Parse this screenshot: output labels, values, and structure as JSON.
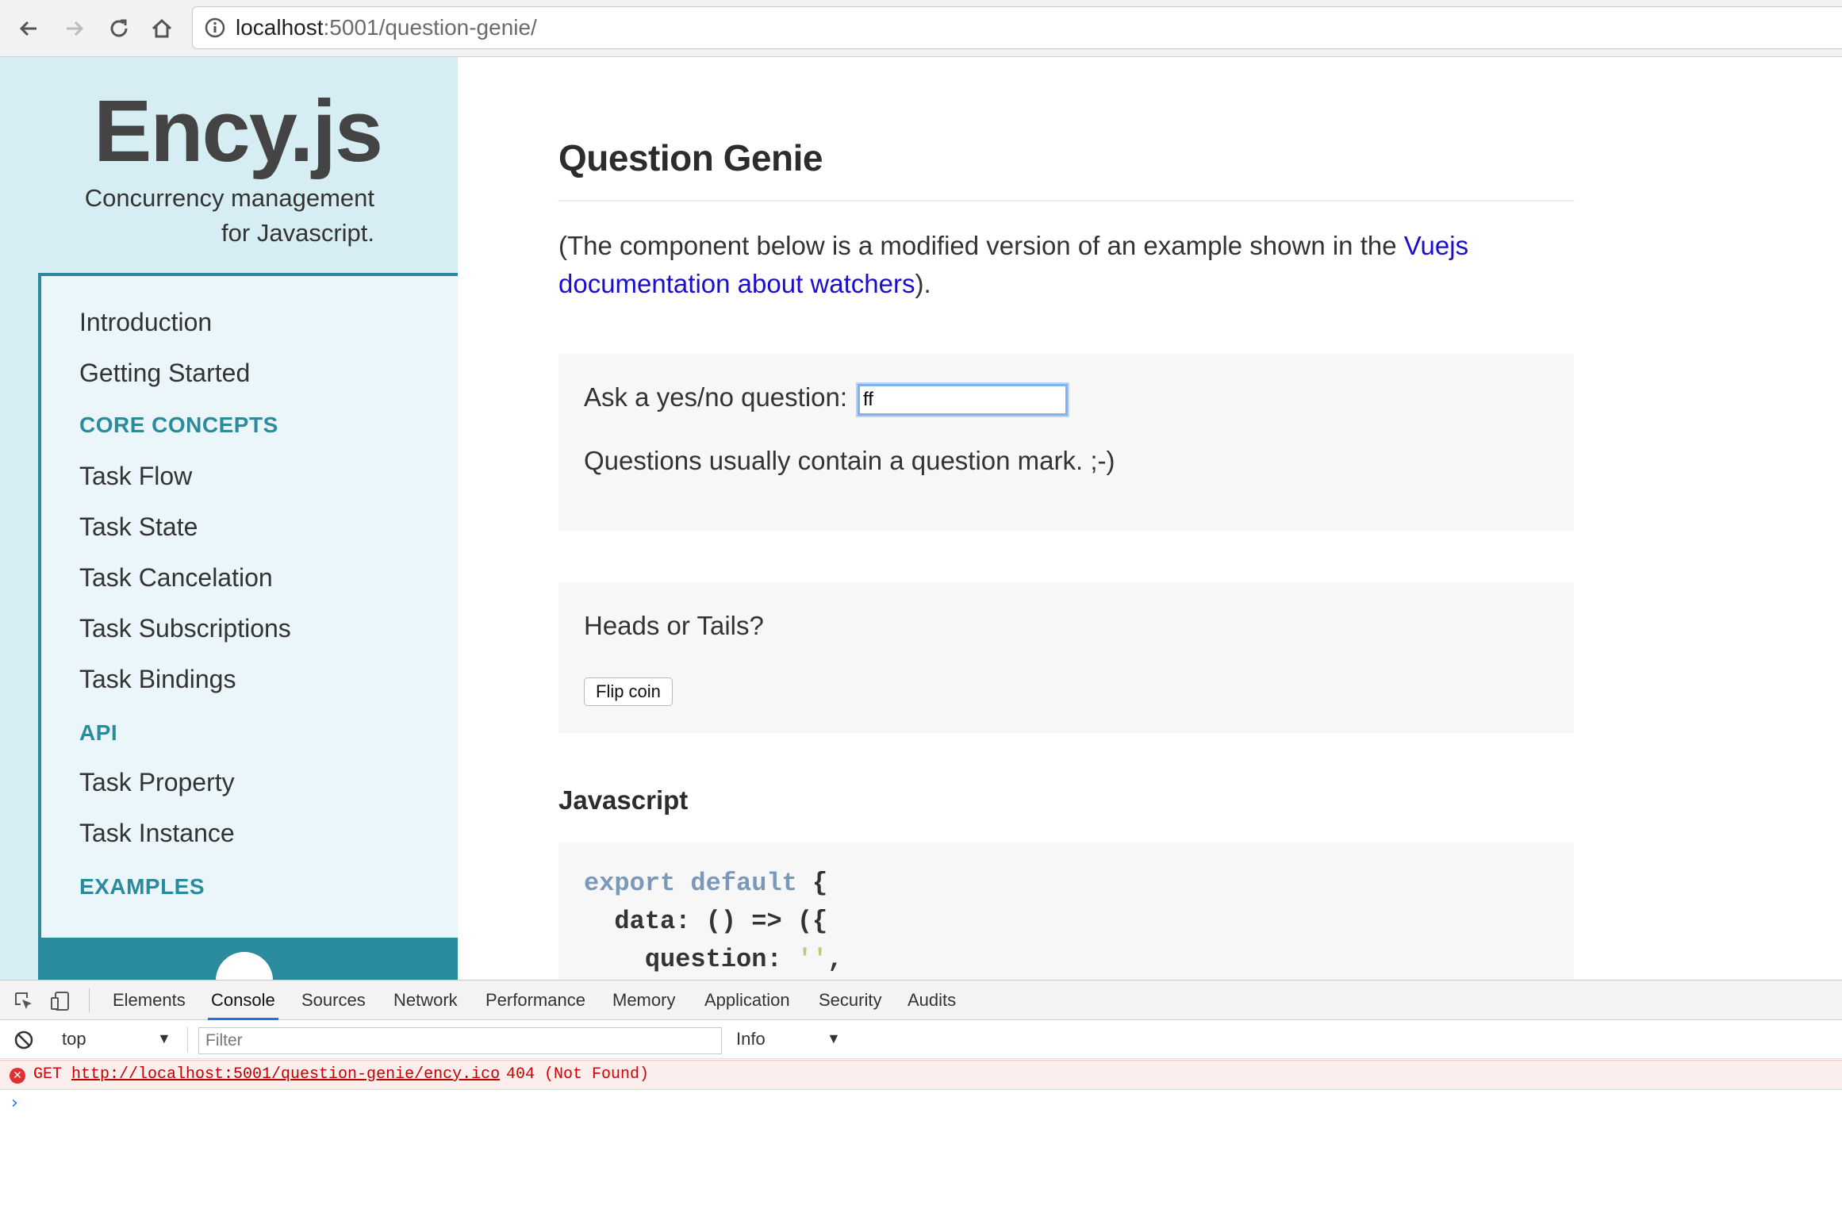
{
  "browser": {
    "url_host": "localhost",
    "url_path": ":5001/question-genie/"
  },
  "sidebar": {
    "brand_title": "Ency.js",
    "brand_subtitle_line1": "Concurrency management",
    "brand_subtitle_line2": "for Javascript.",
    "items": [
      {
        "label": "Introduction",
        "type": "link"
      },
      {
        "label": "Getting Started",
        "type": "link"
      },
      {
        "label": "CORE CONCEPTS",
        "type": "section"
      },
      {
        "label": "Task Flow",
        "type": "link"
      },
      {
        "label": "Task State",
        "type": "link"
      },
      {
        "label": "Task Cancelation",
        "type": "link"
      },
      {
        "label": "Task Subscriptions",
        "type": "link"
      },
      {
        "label": "Task Bindings",
        "type": "link"
      },
      {
        "label": "API",
        "type": "section"
      },
      {
        "label": "Task Property",
        "type": "link"
      },
      {
        "label": "Task Instance",
        "type": "link"
      },
      {
        "label": "EXAMPLES",
        "type": "section"
      }
    ],
    "accent_color": "#2a8a9e"
  },
  "main": {
    "title": "Question Genie",
    "intro_before": "(The component below is a modified version of an example shown in the ",
    "intro_link": "Vuejs documentation about watchers",
    "intro_after": ").",
    "ask_label": "Ask a yes/no question:",
    "ask_value": "ff",
    "ask_answer": "Questions usually contain a question mark. ;-)",
    "coin_label": "Heads or Tails?",
    "flip_button": "Flip coin",
    "js_heading": "Javascript",
    "code": {
      "line1_kw": "export default",
      "line1_rest": " {",
      "line2": "  data: () => ({",
      "line3_pre": "    question: ",
      "line3_str": "''",
      "line3_post": ","
    }
  },
  "devtools": {
    "tabs": [
      "Elements",
      "Console",
      "Sources",
      "Network",
      "Performance",
      "Memory",
      "Application",
      "Security",
      "Audits"
    ],
    "active_tab": "Console",
    "context": "top",
    "filter_placeholder": "Filter",
    "level": "Info",
    "error": {
      "method": "GET",
      "url": "http://localhost:5001/question-genie/ency.ico",
      "status": "404 (Not Found)"
    },
    "prompt": "›"
  }
}
